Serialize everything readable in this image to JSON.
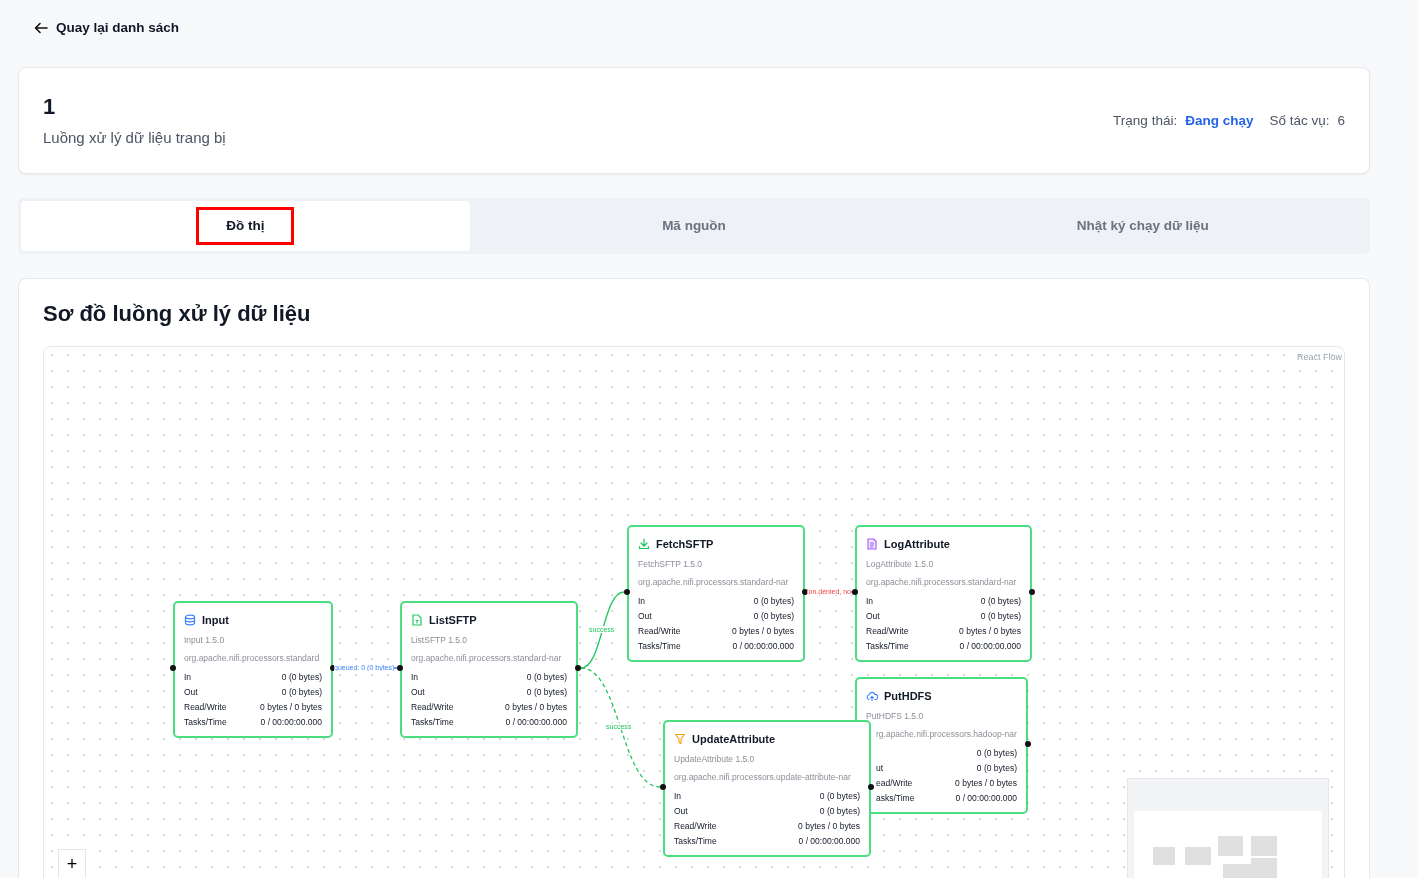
{
  "back_link": {
    "label": "Quay lại danh sách"
  },
  "header": {
    "title": "1",
    "subtitle": "Luồng xử lý dữ liệu trang bị",
    "status_label": "Trạng thái:",
    "status_value": "Đang chạy",
    "tasks_label": "Số tác vụ:",
    "tasks_value": "6"
  },
  "tabs": [
    {
      "label": "Đồ thị",
      "selected": true,
      "highlighted": true
    },
    {
      "label": "Mã nguồn",
      "selected": false,
      "highlighted": false
    },
    {
      "label": "Nhật ký chạy dữ liệu",
      "selected": false,
      "highlighted": false
    }
  ],
  "diagram": {
    "title": "Sơ đồ luồng xử lý dữ liệu",
    "attribution": "React Flow",
    "zoom_in": "+",
    "nodes": [
      {
        "name": "Input",
        "version": "Input 1.5.0",
        "package": "org.apache.nifi.processors.standard",
        "rows": [
          {
            "label": "In",
            "value": "0 (0 bytes)"
          },
          {
            "label": "Out",
            "value": "0 (0 bytes)"
          },
          {
            "label": "Read/Write",
            "value": "0 bytes / 0 bytes"
          },
          {
            "label": "Tasks/Time",
            "value": "0 / 00:00:00.000"
          }
        ]
      },
      {
        "name": "ListSFTP",
        "version": "ListSFTP 1.5.0",
        "package": "org.apache.nifi.processors.standard-nar",
        "rows": [
          {
            "label": "In",
            "value": "0 (0 bytes)"
          },
          {
            "label": "Out",
            "value": "0 (0 bytes)"
          },
          {
            "label": "Read/Write",
            "value": "0 bytes / 0 bytes"
          },
          {
            "label": "Tasks/Time",
            "value": "0 / 00:00:00.000"
          }
        ]
      },
      {
        "name": "FetchSFTP",
        "version": "FetchSFTP 1.5.0",
        "package": "org.apache.nifi.processors.standard-nar",
        "rows": [
          {
            "label": "In",
            "value": "0 (0 bytes)"
          },
          {
            "label": "Out",
            "value": "0 (0 bytes)"
          },
          {
            "label": "Read/Write",
            "value": "0 bytes / 0 bytes"
          },
          {
            "label": "Tasks/Time",
            "value": "0 / 00:00:00.000"
          }
        ]
      },
      {
        "name": "LogAttribute",
        "version": "LogAttribute 1.5.0",
        "package": "org.apache.nifi.processors.standard-nar",
        "rows": [
          {
            "label": "In",
            "value": "0 (0 bytes)"
          },
          {
            "label": "Out",
            "value": "0 (0 bytes)"
          },
          {
            "label": "Read/Write",
            "value": "0 bytes / 0 bytes"
          },
          {
            "label": "Tasks/Time",
            "value": "0 / 00:00:00.000"
          }
        ]
      },
      {
        "name": "PutHDFS",
        "version": "PutHDFS 1.5.0",
        "package": "rg.apache.nifi.processors.hadoop-nar",
        "rows": [
          {
            "value": "0 (0 bytes)"
          },
          {
            "label": "ut",
            "value": "0 (0 bytes)"
          },
          {
            "label": "ead/Write",
            "value": "0 bytes / 0 bytes"
          },
          {
            "label": "asks/Time",
            "value": "0 / 00:00:00.000"
          }
        ]
      },
      {
        "name": "UpdateAttribute",
        "version": "UpdateAttribute 1.5.0",
        "package": "org.apache.nifi.processors.update-attribute-nar",
        "rows": [
          {
            "label": "In",
            "value": "0 (0 bytes)"
          },
          {
            "label": "Out",
            "value": "0 (0 bytes)"
          },
          {
            "label": "Read/Write",
            "value": "0 bytes / 0 bytes"
          },
          {
            "label": "Tasks/Time",
            "value": "0 / 00:00:00.000"
          }
        ]
      }
    ],
    "edges": [
      {
        "label": "queued: 0 (0 bytes)",
        "color": "#3b82f6",
        "animated": false
      },
      {
        "label": "success",
        "color": "#22c55e",
        "animated": false
      },
      {
        "label": "success",
        "color": "#22c55e",
        "animated": true
      },
      {
        "label": "ion.denied, no",
        "color": "#ef4444"
      }
    ]
  }
}
